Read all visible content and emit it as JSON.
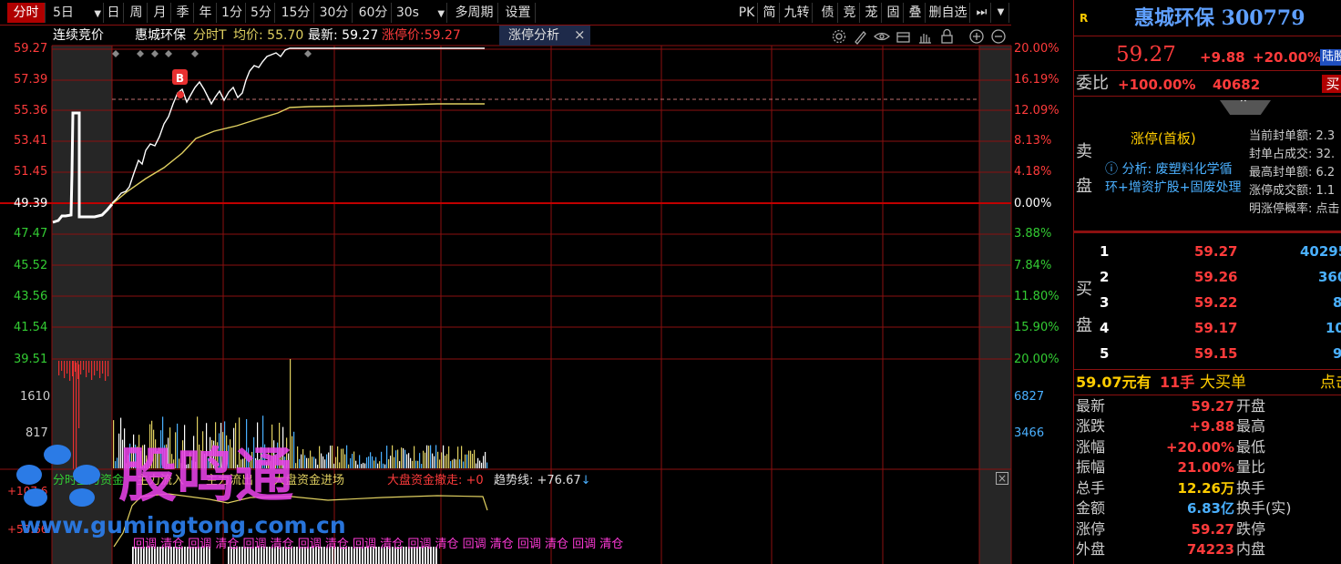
{
  "toolbar": {
    "left": [
      "分时",
      "5日",
      "日",
      "周",
      "月",
      "季",
      "年",
      "1分",
      "5分",
      "15分",
      "30分",
      "60分",
      "30s",
      "多周期",
      "设置"
    ],
    "right": [
      "PK",
      "简",
      "九转",
      "债",
      "竞",
      "茏",
      "固",
      "叠",
      "删自选"
    ]
  },
  "header": {
    "mode": "连续竞价",
    "stock_name": "惠城环保",
    "chart_type": "分时T",
    "avg_label": "均价: 55.70",
    "latest_label": "最新: 59.27",
    "limit_label": "涨停价:59.27",
    "tab_label": "涨停分析",
    "tab_close": "×"
  },
  "price_axis": {
    "left": [
      "59.27",
      "57.39",
      "55.36",
      "53.41",
      "51.45",
      "49.39",
      "47.47",
      "45.52",
      "43.56",
      "41.54",
      "39.51"
    ],
    "right": [
      "20.00%",
      "16.19%",
      "12.09%",
      "8.13%",
      "4.18%",
      "0.00%",
      "3.88%",
      "7.84%",
      "11.80%",
      "15.90%",
      "20.00%"
    ]
  },
  "volume_axis": {
    "left": [
      "1610",
      "817"
    ],
    "right": [
      "6827",
      "3466"
    ]
  },
  "indicator": {
    "items": [
      "分时主力资金",
      "主力流入",
      "主力流出",
      "大盘资金进场",
      "大盘资金撤走: +0"
    ],
    "trend_line": "趋势线: +76.67",
    "left_values": [
      "+107.6",
      "+53.66"
    ]
  },
  "bottom_labels": "回调 清仓 回调 清仓 回调 清仓 回调 清仓 回调 清仓 回调 清仓 回调 清仓 回调 清仓 回调 清仓",
  "marker": "B",
  "watermark": {
    "brand": "股鸣通",
    "url": "www.gumingtong.com.cn"
  },
  "panel": {
    "badge": "R",
    "title": "惠城环保 300779",
    "price": "59.27",
    "change": "+9.88",
    "pct": "+20.00%",
    "tag": "陆股",
    "weibi_label": "委比",
    "weibi_pct": "+100.00%",
    "weibi_num": "40682",
    "weibi_btn": "买",
    "sell_label": "卖\n盘",
    "limit_title": "涨停(首板)",
    "analysis": "ⓘ 分析: 废塑料化学循环+增资扩股+固废处理",
    "seal_stats": [
      "当前封单额: 2.3",
      "封单占成交: 32.",
      "最高封单额: 6.2",
      "涨停成交额: 1.1",
      "明涨停概率: 点击"
    ],
    "buy_label": "买\n盘",
    "bids": [
      {
        "n": "1",
        "p": "59.27",
        "v": "40295"
      },
      {
        "n": "2",
        "p": "59.26",
        "v": "360"
      },
      {
        "n": "3",
        "p": "59.22",
        "v": "8"
      },
      {
        "n": "4",
        "p": "59.17",
        "v": "10"
      },
      {
        "n": "5",
        "p": "59.15",
        "v": "9"
      }
    ],
    "big_order": {
      "price": "59.07元有",
      "qty": "11手",
      "text": "大买单",
      "link": "点击"
    },
    "stats": [
      {
        "l": "最新",
        "v": "59.27",
        "r": "开盘"
      },
      {
        "l": "涨跌",
        "v": "+9.88",
        "r": "最高"
      },
      {
        "l": "涨幅",
        "v": "+20.00%",
        "r": "最低"
      },
      {
        "l": "振幅",
        "v": "21.00%",
        "r": "量比"
      },
      {
        "l": "总手",
        "v": "12.26万",
        "r": "换手"
      },
      {
        "l": "金额",
        "v": "6.83亿",
        "r": "换手(实)"
      },
      {
        "l": "涨停",
        "v": "59.27",
        "r": "跌停"
      },
      {
        "l": "外盘",
        "v": "74223",
        "r": "内盘"
      }
    ]
  },
  "colors": {
    "up": "#ff3b3b",
    "down": "#33cc33",
    "grid": "#8b1010",
    "gold": "#e0d060",
    "blue": "#4ab0ff",
    "magenta": "#ff3ad8"
  }
}
